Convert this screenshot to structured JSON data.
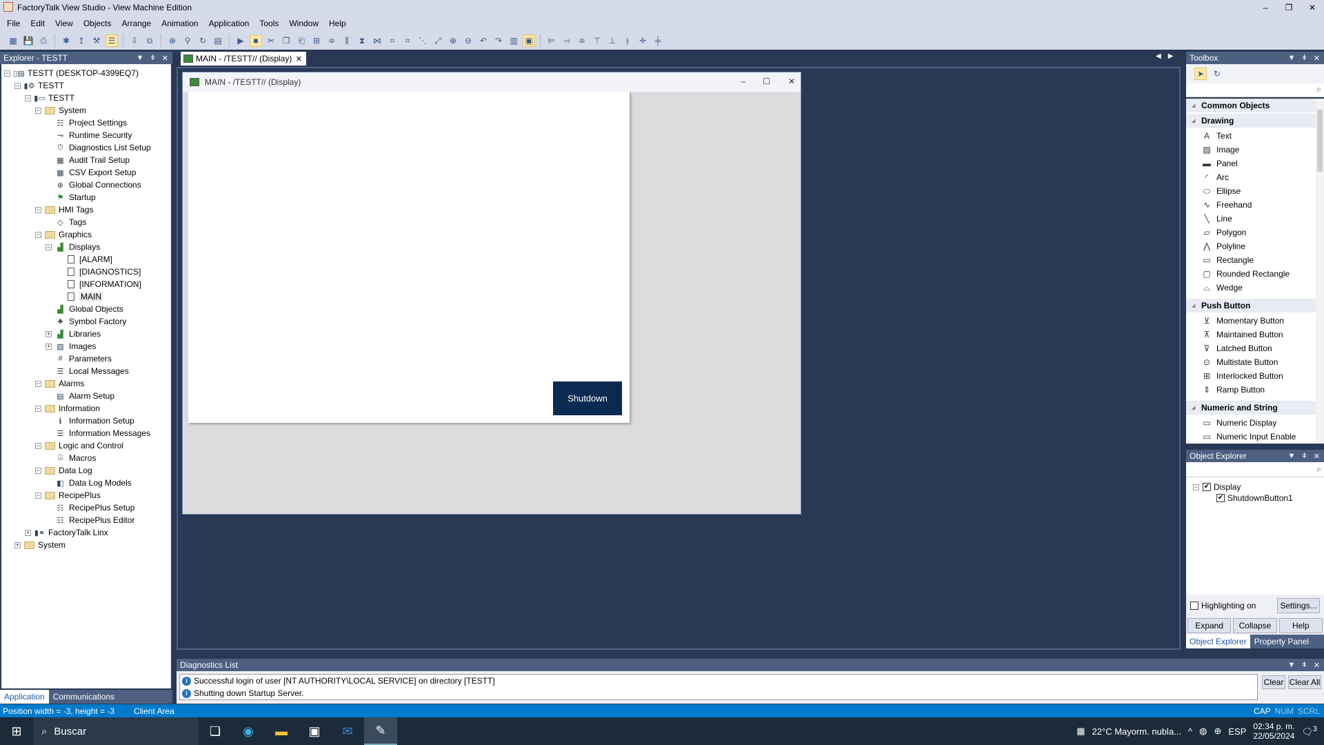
{
  "window": {
    "title": "FactoryTalk View Studio - View Machine Edition"
  },
  "menu": [
    "File",
    "Edit",
    "View",
    "Objects",
    "Arrange",
    "Animation",
    "Application",
    "Tools",
    "Window",
    "Help"
  ],
  "explorer": {
    "title": "Explorer - TESTT",
    "tree": [
      {
        "label": "TESTT (DESKTOP-4399EQ7)",
        "level": 0,
        "exp": "-",
        "icon": "application-icon"
      },
      {
        "label": "TESTT",
        "level": 1,
        "exp": "-",
        "icon": "server-icon"
      },
      {
        "label": "TESTT",
        "level": 2,
        "exp": "-",
        "icon": "hmi-server-icon"
      },
      {
        "label": "System",
        "level": 3,
        "exp": "-",
        "icon": "folder-icon"
      },
      {
        "label": "Project Settings",
        "level": 4,
        "exp": "",
        "icon": "settings-icon"
      },
      {
        "label": "Runtime Security",
        "level": 4,
        "exp": "",
        "icon": "key-icon"
      },
      {
        "label": "Diagnostics List Setup",
        "level": 4,
        "exp": "",
        "icon": "stopwatch-icon"
      },
      {
        "label": "Audit Trail Setup",
        "level": 4,
        "exp": "",
        "icon": "audit-icon"
      },
      {
        "label": "CSV Export Setup",
        "level": 4,
        "exp": "",
        "icon": "csv-icon"
      },
      {
        "label": "Global Connections",
        "level": 4,
        "exp": "",
        "icon": "globe-icon"
      },
      {
        "label": "Startup",
        "level": 4,
        "exp": "",
        "icon": "flag-icon"
      },
      {
        "label": "HMI Tags",
        "level": 3,
        "exp": "-",
        "icon": "folder-icon"
      },
      {
        "label": "Tags",
        "level": 4,
        "exp": "",
        "icon": "tag-icon"
      },
      {
        "label": "Graphics",
        "level": 3,
        "exp": "-",
        "icon": "folder-icon"
      },
      {
        "label": "Displays",
        "level": 4,
        "exp": "-",
        "icon": "displays-icon"
      },
      {
        "label": "[ALARM]",
        "level": 5,
        "exp": "",
        "icon": "document-icon"
      },
      {
        "label": "[DIAGNOSTICS]",
        "level": 5,
        "exp": "",
        "icon": "document-icon"
      },
      {
        "label": "[INFORMATION]",
        "level": 5,
        "exp": "",
        "icon": "document-icon"
      },
      {
        "label": "MAIN",
        "level": 5,
        "exp": "",
        "icon": "document-icon",
        "selected": true
      },
      {
        "label": "Global Objects",
        "level": 4,
        "exp": "",
        "icon": "displays-icon"
      },
      {
        "label": "Symbol Factory",
        "level": 4,
        "exp": "",
        "icon": "symbol-icon"
      },
      {
        "label": "Libraries",
        "level": 4,
        "exp": "+",
        "icon": "displays-icon"
      },
      {
        "label": "Images",
        "level": 4,
        "exp": "+",
        "icon": "image-icon"
      },
      {
        "label": "Parameters",
        "level": 4,
        "exp": "",
        "icon": "parameters-icon"
      },
      {
        "label": "Local Messages",
        "level": 4,
        "exp": "",
        "icon": "messages-icon"
      },
      {
        "label": "Alarms",
        "level": 3,
        "exp": "-",
        "icon": "folder-icon"
      },
      {
        "label": "Alarm Setup",
        "level": 4,
        "exp": "",
        "icon": "alarm-icon"
      },
      {
        "label": "Information",
        "level": 3,
        "exp": "-",
        "icon": "folder-icon"
      },
      {
        "label": "Information Setup",
        "level": 4,
        "exp": "",
        "icon": "info-setup-icon"
      },
      {
        "label": "Information Messages",
        "level": 4,
        "exp": "",
        "icon": "messages-icon"
      },
      {
        "label": "Logic and Control",
        "level": 3,
        "exp": "-",
        "icon": "folder-icon"
      },
      {
        "label": "Macros",
        "level": 4,
        "exp": "",
        "icon": "macro-icon"
      },
      {
        "label": "Data Log",
        "level": 3,
        "exp": "-",
        "icon": "folder-icon"
      },
      {
        "label": "Data Log Models",
        "level": 4,
        "exp": "",
        "icon": "datalog-icon"
      },
      {
        "label": "RecipePlus",
        "level": 3,
        "exp": "-",
        "icon": "folder-icon"
      },
      {
        "label": "RecipePlus Setup",
        "level": 4,
        "exp": "",
        "icon": "recipe-icon"
      },
      {
        "label": "RecipePlus Editor",
        "level": 4,
        "exp": "",
        "icon": "recipe-icon"
      },
      {
        "label": "FactoryTalk Linx",
        "level": 2,
        "exp": "+",
        "icon": "linx-icon"
      },
      {
        "label": "System",
        "level": 1,
        "exp": "+",
        "icon": "folder-icon"
      }
    ],
    "tabs": [
      "Application",
      "Communications"
    ]
  },
  "document": {
    "tab": "MAIN - /TESTT// (Display)",
    "window_title": "MAIN - /TESTT// (Display)",
    "button_label": "Shutdown"
  },
  "toolbox": {
    "title": "Toolbox",
    "sections": [
      {
        "title": "Common Objects",
        "items": []
      },
      {
        "title": "Drawing",
        "items": [
          "Text",
          "Image",
          "Panel",
          "Arc",
          "Ellipse",
          "Freehand",
          "Line",
          "Polygon",
          "Polyline",
          "Rectangle",
          "Rounded Rectangle",
          "Wedge"
        ]
      },
      {
        "title": "Push Button",
        "items": [
          "Momentary Button",
          "Maintained Button",
          "Latched Button",
          "Multistate Button",
          "Interlocked Button",
          "Ramp Button"
        ]
      },
      {
        "title": "Numeric and String",
        "items": [
          "Numeric Display",
          "Numeric Input Enable"
        ]
      }
    ]
  },
  "object_explorer": {
    "title": "Object Explorer",
    "root": "Display",
    "child": "ShutdownButton1",
    "highlighting": "Highlighting on",
    "settings": "Settings...",
    "expand": "Expand",
    "collapse": "Collapse",
    "help": "Help",
    "tabs": [
      "Object Explorer",
      "Property Panel"
    ]
  },
  "diagnostics": {
    "title": "Diagnostics List",
    "messages": [
      "Successful login of user [NT AUTHORITY\\LOCAL SERVICE] on directory [TESTT]",
      "Shutting down Startup Server."
    ],
    "clear": "Clear",
    "clear_all": "Clear All"
  },
  "status": {
    "position": "Position width = -3, height = -3",
    "area": "Client Area",
    "keys": [
      "CAP",
      "NUM",
      "SCRL"
    ]
  },
  "taskbar": {
    "search": "Buscar",
    "weather": "22°C  Mayorm. nubla...",
    "lang": "ESP",
    "time": "02:34 p. m.",
    "date": "22/05/2024",
    "notifications": "3"
  },
  "colors": {
    "accent": "#007acc",
    "panel_header": "#4d6082",
    "background": "#293955",
    "button": "#0b2a52"
  }
}
